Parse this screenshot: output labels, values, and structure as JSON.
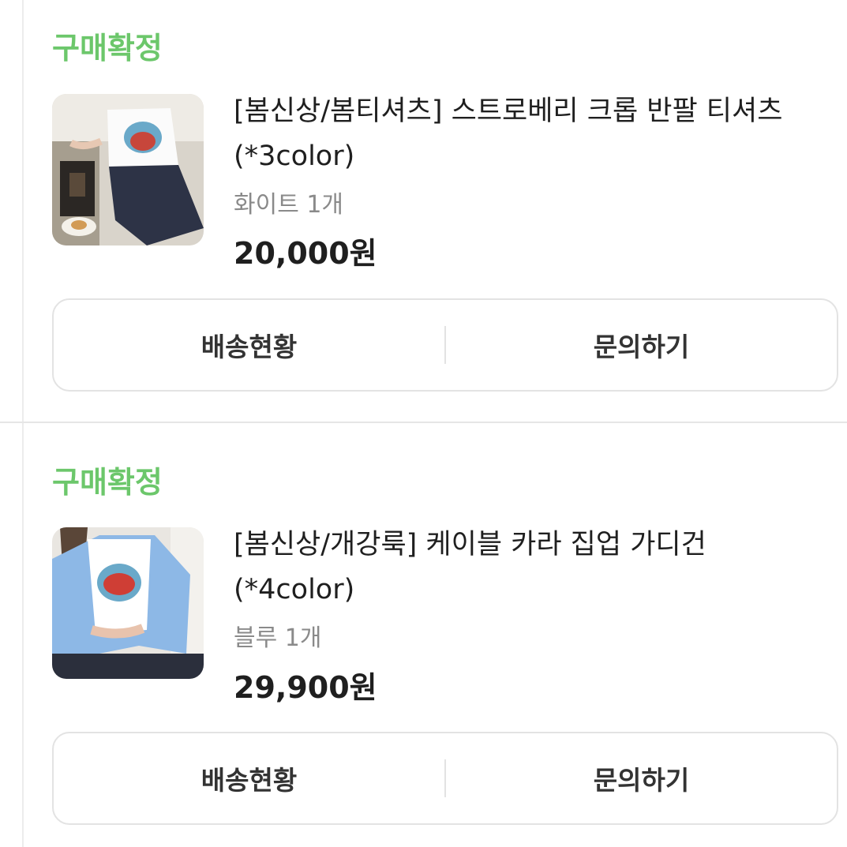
{
  "orders": [
    {
      "status": "구매확정",
      "product_name": "[봄신상/봄티셔츠] 스트로베리 크롭 반팔 티셔츠 (*3color)",
      "option": "화이트 1개",
      "price": "20,000원",
      "thumbnail_icon": "product-photo-white-tee",
      "actions": {
        "shipping": "배송현황",
        "inquiry": "문의하기"
      }
    },
    {
      "status": "구매확정",
      "product_name": "[봄신상/개강룩] 케이블 카라 집업 가디건 (*4color)",
      "option": "블루 1개",
      "price": "29,900원",
      "thumbnail_icon": "product-photo-blue-cardigan",
      "actions": {
        "shipping": "배송현황",
        "inquiry": "문의하기"
      }
    }
  ],
  "colors": {
    "status_green": "#6cc76b",
    "text_primary": "#1f1f1f",
    "text_secondary": "#8a8a8a",
    "border": "#e3e3e3"
  }
}
